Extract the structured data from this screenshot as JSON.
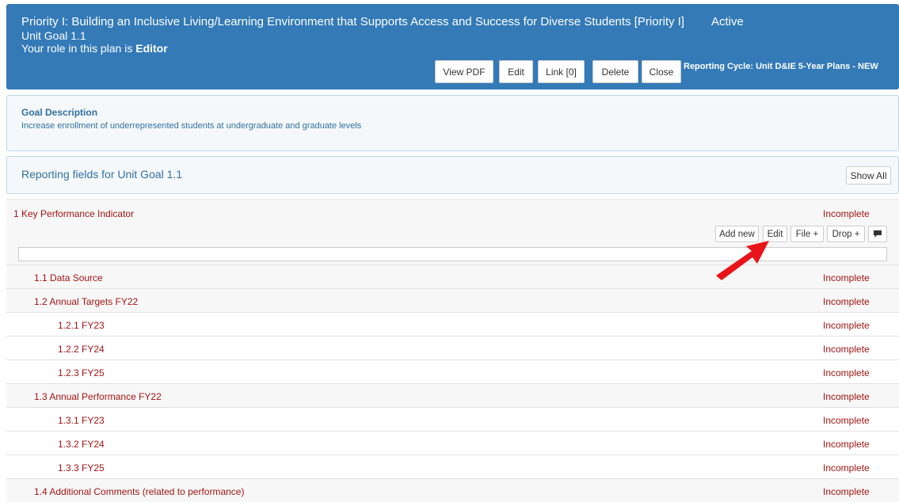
{
  "header": {
    "title": "Priority I: Building an Inclusive Living/Learning Environment that Supports Access and Success for Diverse Students [Priority I]",
    "status": "Active",
    "subtitle": "Unit Goal 1.1",
    "role_prefix": "Your role in this plan is",
    "role": "Editor",
    "buttons": {
      "view_pdf": "View PDF",
      "edit": "Edit",
      "link": "Link [0]",
      "delete": "Delete",
      "close": "Close"
    },
    "cycle_label": "Reporting Cycle:",
    "cycle_value": "Unit D&IE 5-Year Plans - NEW"
  },
  "goal": {
    "label": "Goal Description",
    "description": "Increase enrollment of underrepresented students at undergraduate and graduate levels"
  },
  "fields": {
    "title": "Reporting fields for Unit Goal 1.1",
    "show_all": "Show All"
  },
  "kpi": {
    "name": "1 Key Performance Indicator",
    "status": "Incomplete",
    "actions": {
      "add_new": "Add new",
      "edit": "Edit",
      "file": "File +",
      "drop": "Drop +"
    }
  },
  "rows": [
    {
      "name": "1.1 Data Source",
      "status": "Incomplete"
    },
    {
      "name": "1.2 Annual Targets FY22",
      "status": "Incomplete"
    },
    {
      "name": "1.2.1 FY23",
      "status": "Incomplete"
    },
    {
      "name": "1.2.2 FY24",
      "status": "Incomplete"
    },
    {
      "name": "1.2.3 FY25",
      "status": "Incomplete"
    },
    {
      "name": "1.3 Annual Performance FY22",
      "status": "Incomplete"
    },
    {
      "name": "1.3.1 FY23",
      "status": "Incomplete"
    },
    {
      "name": "1.3.2 FY24",
      "status": "Incomplete"
    },
    {
      "name": "1.3.3 FY25",
      "status": "Incomplete"
    },
    {
      "name": "1.4 Additional Comments (related to performance)",
      "status": "Incomplete"
    }
  ],
  "colors": {
    "header_bg": "#337ab7",
    "panel_text": "#31709f",
    "field_text": "#a31515",
    "annotation_arrow": "#e8141a"
  },
  "icons": {
    "comment": "comment-icon",
    "arrow": "annotation-arrow-icon"
  }
}
